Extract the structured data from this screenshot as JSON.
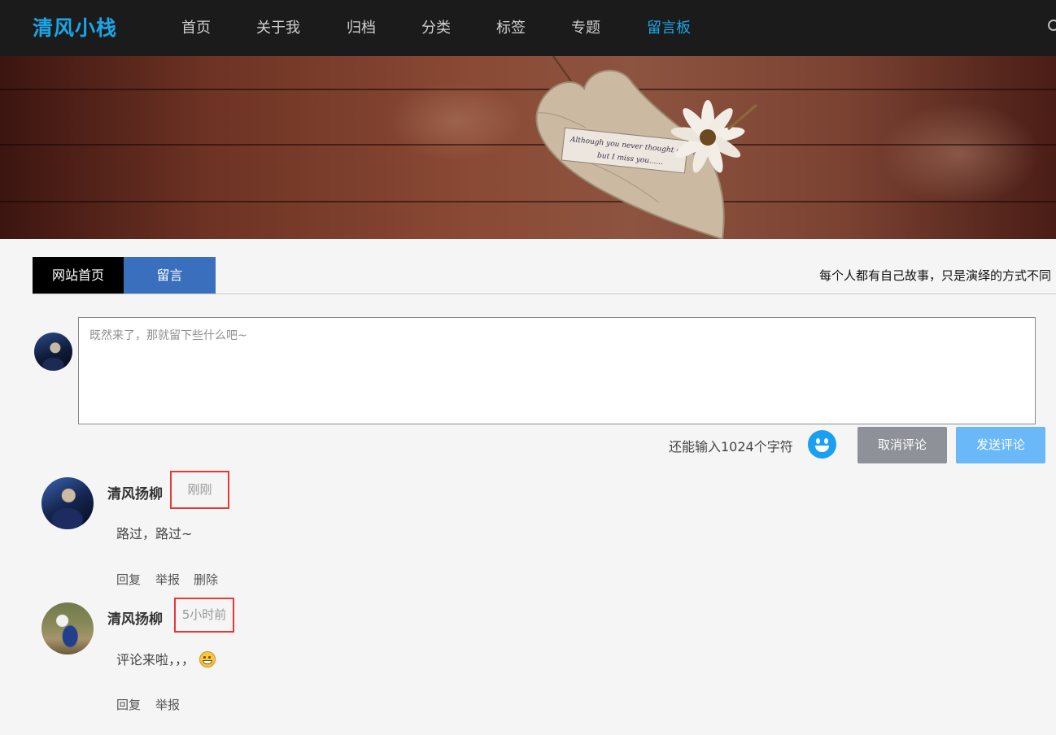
{
  "header": {
    "logo": "清风小栈",
    "nav": [
      {
        "label": "首页",
        "active": false
      },
      {
        "label": "关于我",
        "active": false
      },
      {
        "label": "归档",
        "active": false
      },
      {
        "label": "分类",
        "active": false
      },
      {
        "label": "标签",
        "active": false
      },
      {
        "label": "专题",
        "active": false
      },
      {
        "label": "留言板",
        "active": true
      }
    ],
    "search_icon": "search-icon"
  },
  "banner": {
    "note_line1": "Although you never thought of me",
    "note_line2": "but I miss you......"
  },
  "tabs": {
    "home": "网站首页",
    "message": "留言",
    "motto": "每个人都有自己故事，只是演绎的方式不同"
  },
  "composer": {
    "placeholder": "既然来了，那就留下些什么吧~",
    "value": "",
    "char_count": "还能输入1024个字符",
    "emoji_icon": "smile-icon",
    "cancel_label": "取消评论",
    "send_label": "发送评论"
  },
  "comments": [
    {
      "author": "清风扬柳",
      "time": "刚刚",
      "text": "路过，路过~",
      "actions": [
        "回复",
        "举报",
        "删除"
      ]
    },
    {
      "author": "清风扬柳",
      "time": "5小时前",
      "text": "评论来啦，，，",
      "emoji": "grin-icon",
      "actions": [
        "回复",
        "举报"
      ]
    }
  ],
  "colors": {
    "accent": "#1aa6e8",
    "nav_bg": "#1b1b1b",
    "tab_active_bg": "#3a6fbd",
    "send_button": "#6ab8f7",
    "cancel_button": "#8e9197",
    "highlight_border": "#e53935"
  }
}
